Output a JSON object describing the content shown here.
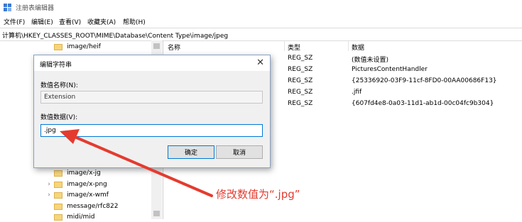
{
  "window": {
    "title": "注册表编辑器"
  },
  "menu": [
    "文件(F)",
    "编辑(E)",
    "查看(V)",
    "收藏夹(A)",
    "帮助(H)"
  ],
  "address": "计算机\\HKEY_CLASSES_ROOT\\MIME\\Database\\Content Type\\image/jpeg",
  "tree": {
    "items": [
      {
        "label": "image/heif"
      },
      {
        "label": "image/x-jg"
      },
      {
        "label": "image/x-png"
      },
      {
        "label": "image/x-wmf"
      },
      {
        "label": "message/rfc822"
      },
      {
        "label": "midi/mid"
      }
    ]
  },
  "list": {
    "headers": {
      "name": "名称",
      "type": "类型",
      "data": "数据"
    },
    "rows": [
      {
        "type": "REG_SZ",
        "data": "(数值未设置)"
      },
      {
        "type": "REG_SZ",
        "data": "PicturesContentHandler"
      },
      {
        "type": "REG_SZ",
        "data": "{25336920-03F9-11cf-8FD0-00AA00686F13}"
      },
      {
        "type": "REG_SZ",
        "data": ".jfif"
      },
      {
        "type": "REG_SZ",
        "data": "{607fd4e8-0a03-11d1-ab1d-00c04fc9b304}"
      }
    ]
  },
  "dialog": {
    "title": "编辑字符串",
    "close": "✕",
    "name_label": "数值名称(N):",
    "name_value": "Extension",
    "data_label": "数值数据(V):",
    "data_value": ".jpg",
    "ok": "确定",
    "cancel": "取消"
  },
  "annotation": "修改数值为“.jpg”",
  "colors": {
    "annotation": "#e43b2f",
    "accent": "#0078d7",
    "folder": "#f7d57a"
  }
}
